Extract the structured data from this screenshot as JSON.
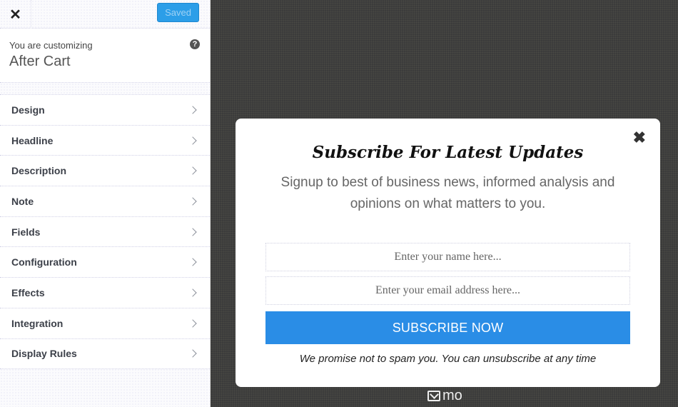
{
  "sidebar": {
    "close_icon": "close-icon",
    "saved_label": "Saved",
    "customizing_label": "You are customizing",
    "customizing_title": "After Cart",
    "help_icon": "?",
    "items": [
      {
        "label": "Design"
      },
      {
        "label": "Headline"
      },
      {
        "label": "Description"
      },
      {
        "label": "Note"
      },
      {
        "label": "Fields"
      },
      {
        "label": "Configuration"
      },
      {
        "label": "Effects"
      },
      {
        "label": "Integration"
      },
      {
        "label": "Display Rules"
      }
    ]
  },
  "modal": {
    "close_glyph": "✖",
    "title": "Subscribe For Latest Updates",
    "description": "Signup to best of business news, informed analysis and opinions on what matters to you.",
    "name_placeholder": "Enter your name here...",
    "email_placeholder": "Enter your email address here...",
    "subscribe_label": "SUBSCRIBE NOW",
    "note": "We promise not to spam you. You can unsubscribe at any time",
    "button_color": "#2a8de6"
  },
  "brand": {
    "text": "mo"
  }
}
